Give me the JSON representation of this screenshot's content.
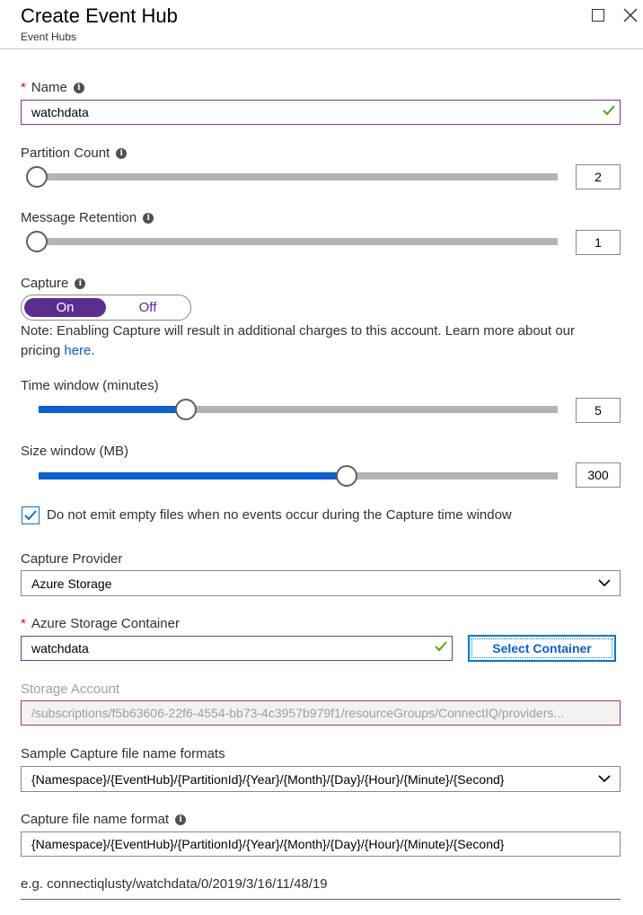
{
  "header": {
    "title": "Create Event Hub",
    "subtitle": "Event Hubs"
  },
  "name_field": {
    "label": "Name",
    "required_mark": "*",
    "value": "watchdata"
  },
  "partition_count": {
    "label": "Partition Count",
    "value": "2",
    "slider_fraction": 0.0
  },
  "message_retention": {
    "label": "Message Retention",
    "value": "1",
    "slider_fraction": 0.0
  },
  "capture": {
    "label": "Capture",
    "on_label": "On",
    "off_label": "Off",
    "selected": "On",
    "note_text": "Note: Enabling Capture will result in additional charges to this account. Learn more about our pricing ",
    "note_link": "here",
    "note_end": "."
  },
  "time_window": {
    "label": "Time window (minutes)",
    "value": "5",
    "slider_fraction": 0.283
  },
  "size_window": {
    "label": "Size window (MB)",
    "value": "300",
    "slider_fraction": 0.593
  },
  "empty_files": {
    "checked": true,
    "label": "Do not emit empty files when no events occur during the Capture time window"
  },
  "capture_provider": {
    "label": "Capture Provider",
    "selected": "Azure Storage"
  },
  "storage_container": {
    "label": "Azure Storage Container",
    "required_mark": "*",
    "value": "watchdata",
    "button_label": "Select Container"
  },
  "storage_account": {
    "label": "Storage Account",
    "value": "/subscriptions/f5b63606-22f6-4554-bb73-4c3957b979f1/resourceGroups/ConnectIQ/providers..."
  },
  "sample_formats": {
    "label": "Sample Capture file name formats",
    "selected": "{Namespace}/{EventHub}/{PartitionId}/{Year}/{Month}/{Day}/{Hour}/{Minute}/{Second}"
  },
  "file_name_format": {
    "label": "Capture file name format",
    "value": "{Namespace}/{EventHub}/{PartitionId}/{Year}/{Month}/{Day}/{Hour}/{Minute}/{Second}"
  },
  "example_text": "e.g. connectiqlusty/watchdata/0/2019/3/16/11/48/19",
  "colors": {
    "accent_purple": "#5c2d91",
    "link_blue": "#0b5ed7",
    "valid_green": "#57a300",
    "required_red": "#c50f1f"
  },
  "icons": [
    "info-icon",
    "checkmark-icon",
    "chevron-down-icon",
    "maximize-icon",
    "close-icon"
  ]
}
